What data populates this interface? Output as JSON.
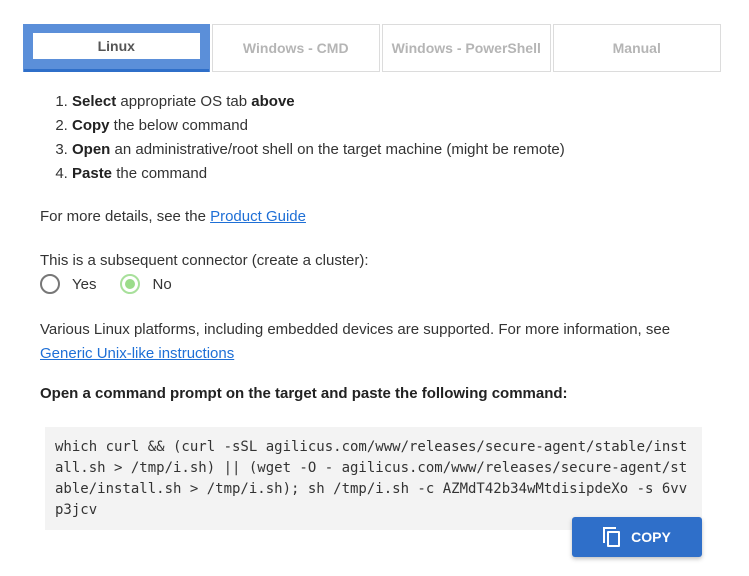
{
  "tabs": [
    {
      "label": "Linux",
      "active": true
    },
    {
      "label": "Windows - CMD",
      "active": false
    },
    {
      "label": "Windows - PowerShell",
      "active": false
    },
    {
      "label": "Manual",
      "active": false
    }
  ],
  "steps": [
    {
      "bold": "Select",
      "text": " appropriate OS tab ",
      "bold2": "above"
    },
    {
      "bold": "Copy",
      "text": " the below command",
      "bold2": ""
    },
    {
      "bold": "Open",
      "text": " an administrative/root shell on the target machine (might be remote)",
      "bold2": ""
    },
    {
      "bold": "Paste",
      "text": " the command",
      "bold2": ""
    }
  ],
  "details": {
    "prefix": "For more details, see the ",
    "link": "Product Guide"
  },
  "subsequent": {
    "label": "This is a subsequent connector (create a cluster):",
    "options": [
      {
        "label": "Yes",
        "selected": false
      },
      {
        "label": "No",
        "selected": true
      }
    ]
  },
  "platforms": {
    "text": "Various Linux platforms, including embedded devices are supported. For more information, see ",
    "link": "Generic Unix-like instructions"
  },
  "command": {
    "title": "Open a command prompt on the target and paste the following command:",
    "code": "which curl && (curl -sSL agilicus.com/www/releases/secure-agent/stable/install.sh > /tmp/i.sh) || (wget -O - agilicus.com/www/releases/secure-agent/stable/install.sh > /tmp/i.sh); sh /tmp/i.sh -c AZMdT42b34wMtdisipdeXo -s 6vvp3jcv",
    "copy_label": "COPY",
    "copy_icon": "copy-icon"
  },
  "colors": {
    "accent": "#2f6fc9",
    "active_tab": "#5b8fd9",
    "link": "#1e6fd6",
    "radio_selected": "#9bdc8a"
  }
}
